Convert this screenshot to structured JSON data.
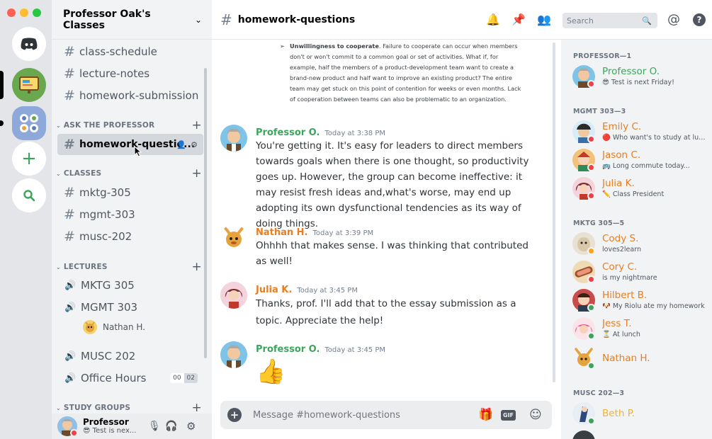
{
  "colors": {
    "professor": "#3ba55c",
    "student": "#e67e22",
    "online": "#3ba55c",
    "dnd": "#ed4245",
    "idle": "#faa61a"
  },
  "servers": [
    {
      "name": "discord-home"
    },
    {
      "name": "classroom-server"
    },
    {
      "name": "study-server"
    }
  ],
  "guild": {
    "name": "Professor Oak's Classes"
  },
  "channels": {
    "top": [
      "class-schedule",
      "lecture-notes",
      "homework-submission"
    ],
    "categories": {
      "ask": "ASK THE PROFESSOR",
      "classes": "CLASSES",
      "lectures": "LECTURES",
      "study": "STUDY GROUPS"
    },
    "active": "homework-questio...",
    "classes": [
      "mktg-305",
      "mgmt-303",
      "musc-202"
    ],
    "voice": [
      "MKTG 305",
      "MGMT 303",
      "MUSC 202",
      "Office Hours"
    ],
    "voice_member": "Nathan H.",
    "office_hours_badges": [
      "00",
      "02"
    ]
  },
  "user_panel": {
    "name": "Professor",
    "status": "Test is nex..."
  },
  "chat": {
    "channel": "homework-questions",
    "excerpt": {
      "bold": "Unwillingness to cooperate",
      "text": ". Failure to cooperate can occur when members don't or won't commit to a common goal or set of activities. What if, for example, half the members of a product-development team want to create a brand-new product and half want to improve an existing product? The entire team may get stuck on this point of contention for weeks or even months. Lack of cooperation between teams can also be problematic to an organization."
    },
    "messages": [
      {
        "author": "Professor O.",
        "time": "Today at 3:38 PM",
        "text": "You're getting it. It's easy for leaders to direct members towards goals when there is one thought, so productivity goes up. However, the group can become ineffective: it may resist fresh ideas and,what's worse, may end up adopting its own dysfunctional tendencies as its way of doing things."
      },
      {
        "author": "Nathan H.",
        "time": "Today at 3:39 PM",
        "text": "Ohhhh that makes sense. I was thinking that contributed as well!"
      },
      {
        "author": "Julia K.",
        "time": "Today at 3:45 PM",
        "text": "Thanks, prof. I'll add that to the essay submission as a topic. Appreciate the help!"
      },
      {
        "author": "Professor O.",
        "time": "Today at 3:45 PM",
        "text": "👍"
      }
    ],
    "composer_placeholder": "Message #homework-questions"
  },
  "toolbar": {
    "search_placeholder": "Search"
  },
  "members": {
    "groups": [
      {
        "title": "PROFESSOR—1",
        "members": [
          {
            "name": "Professor O.",
            "status": "😎 Test is next Friday!",
            "role": "professor",
            "presence": "dnd"
          }
        ]
      },
      {
        "title": "MGMT 303—3",
        "members": [
          {
            "name": "Emily C.",
            "status": "🔴 Who want's to study at lun...",
            "role": "student",
            "presence": "dnd"
          },
          {
            "name": "Jason C.",
            "status": "🚌 Long commute today...",
            "role": "student",
            "presence": "dnd"
          },
          {
            "name": "Julia K.",
            "status": "✏️ Class President",
            "role": "student",
            "presence": "dnd"
          }
        ]
      },
      {
        "title": "MKTG 305—5",
        "members": [
          {
            "name": "Cody S.",
            "status": "loves2learn",
            "role": "student",
            "presence": "idle"
          },
          {
            "name": "Cory C.",
            "status": "is my nightmare",
            "role": "student",
            "presence": "dnd"
          },
          {
            "name": "Hilbert B.",
            "status": "🐶 My Riolu ate my homework",
            "role": "student",
            "presence": "online"
          },
          {
            "name": "Jess T.",
            "status": "⏳ At lunch",
            "role": "student",
            "presence": "online"
          },
          {
            "name": "Nathan H.",
            "status": "",
            "role": "student",
            "presence": "online"
          }
        ]
      },
      {
        "title": "MUSC 202—3",
        "members": [
          {
            "name": "Beth P.",
            "status": "",
            "role": "student",
            "presence": "online"
          }
        ]
      }
    ]
  }
}
